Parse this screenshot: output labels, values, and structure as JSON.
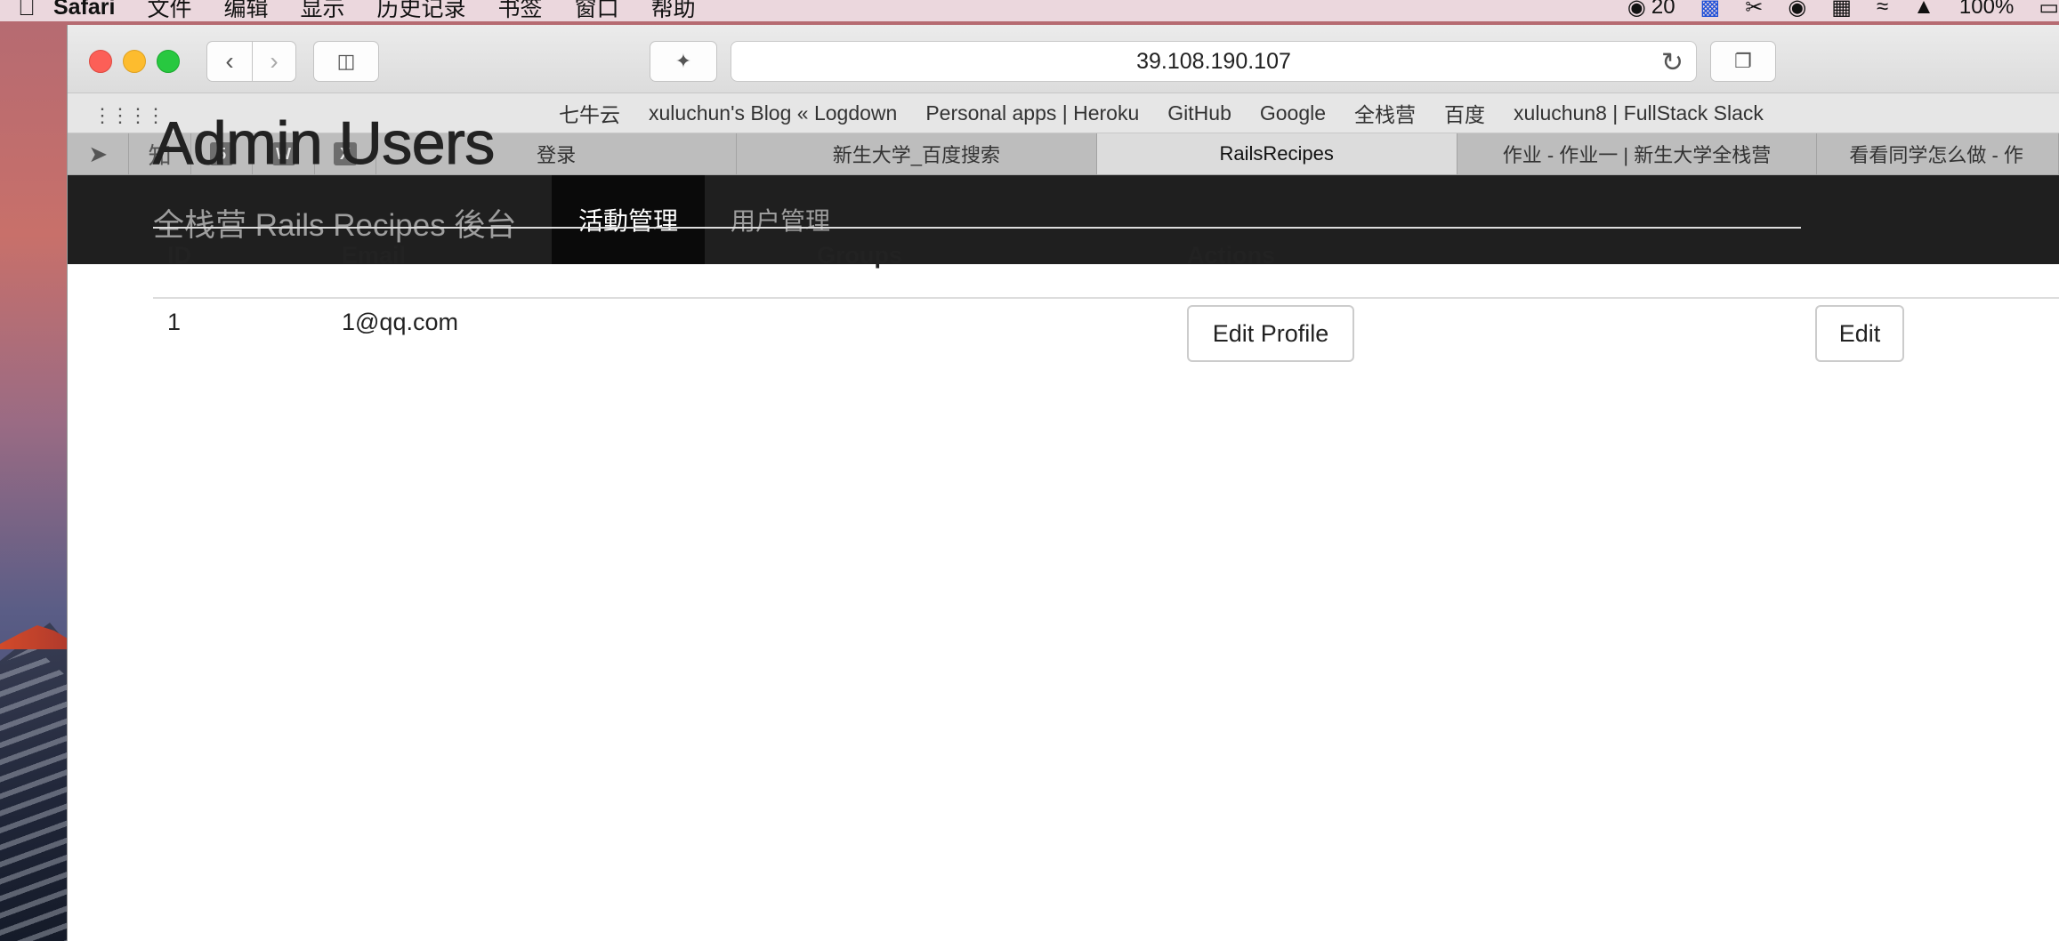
{
  "menubar": {
    "app": "Safari",
    "items": [
      "文件",
      "编辑",
      "显示",
      "历史记录",
      "书签",
      "窗口",
      "帮助"
    ],
    "wechat_count": "20",
    "battery": "100%"
  },
  "toolbar": {
    "address": "39.108.190.107"
  },
  "bookmarks": [
    "七牛云",
    "xuluchun's Blog « Logdown",
    "Personal apps | Heroku",
    "GitHub",
    "Google",
    "全栈营",
    "百度",
    "xuluchun8 | FullStack Slack"
  ],
  "pinned_tabs": [
    "知",
    "5",
    "W",
    "X"
  ],
  "tabs": [
    "登录",
    "新生大学_百度搜索",
    "RailsRecipes",
    "作业 - 作业一 | 新生大学全栈营",
    "看看同学怎么做 - 作"
  ],
  "navbar": {
    "brand": "全栈营 Rails Recipes 後台",
    "items": [
      "活動管理",
      "用户管理"
    ]
  },
  "page": {
    "title": "Admin Users",
    "columns": [
      "ID",
      "Email",
      "Groups",
      "Actions"
    ],
    "rows": [
      {
        "id": "1",
        "email": "1@qq.com",
        "groups": "",
        "edit_profile": "Edit Profile",
        "edit": "Edit"
      }
    ]
  }
}
